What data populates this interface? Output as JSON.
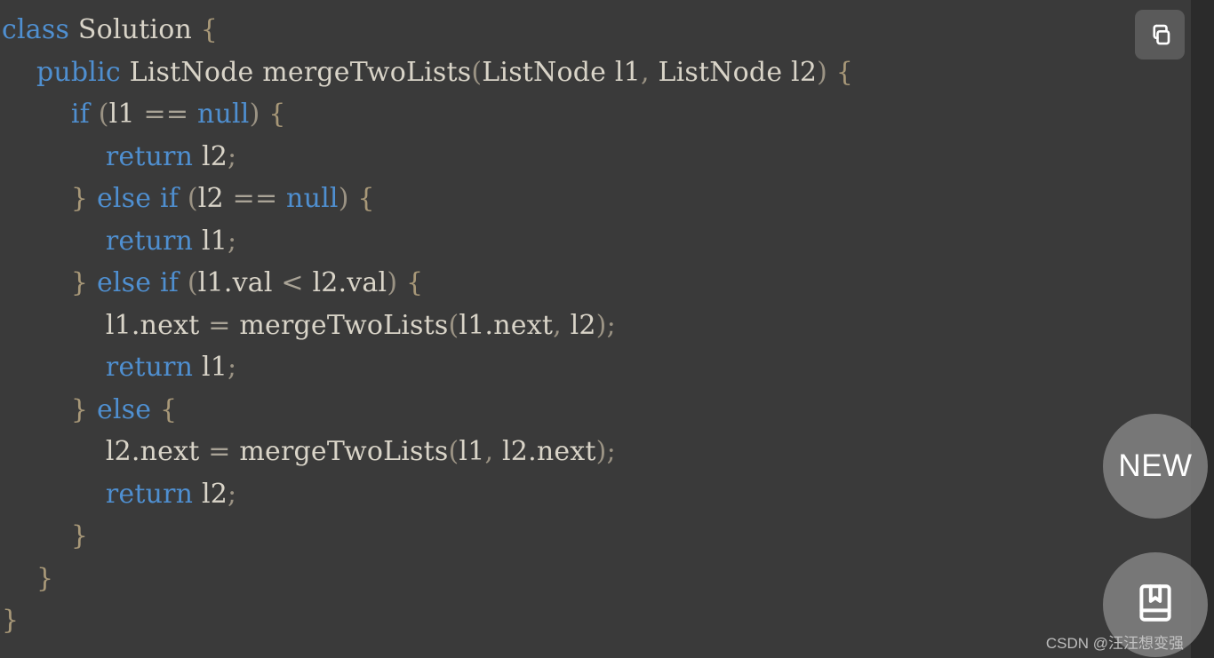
{
  "editor": {
    "language": "java",
    "background_color": "#3a3a3a",
    "rail_color": "#2b2b2b",
    "keyword_color": "#4f8fd0",
    "identifier_color": "#d9d4c8",
    "brace_color": "#a89878",
    "operator_color": "#a9a396",
    "code_lines": [
      [
        {
          "t": "class",
          "c": "kw"
        },
        {
          "t": " ",
          "c": "id"
        },
        {
          "t": "Solution",
          "c": "id"
        },
        {
          "t": " ",
          "c": "id"
        },
        {
          "t": "{",
          "c": "brace"
        }
      ],
      [
        {
          "t": "    ",
          "c": "id"
        },
        {
          "t": "public",
          "c": "kw"
        },
        {
          "t": " ",
          "c": "id"
        },
        {
          "t": "ListNode",
          "c": "id"
        },
        {
          "t": " ",
          "c": "id"
        },
        {
          "t": "mergeTwoLists",
          "c": "id"
        },
        {
          "t": "(",
          "c": "punc"
        },
        {
          "t": "ListNode",
          "c": "id"
        },
        {
          "t": " ",
          "c": "id"
        },
        {
          "t": "l1",
          "c": "id"
        },
        {
          "t": ", ",
          "c": "punc"
        },
        {
          "t": "ListNode",
          "c": "id"
        },
        {
          "t": " ",
          "c": "id"
        },
        {
          "t": "l2",
          "c": "id"
        },
        {
          "t": ")",
          "c": "punc"
        },
        {
          "t": " ",
          "c": "id"
        },
        {
          "t": "{",
          "c": "brace"
        }
      ],
      [
        {
          "t": "        ",
          "c": "id"
        },
        {
          "t": "if",
          "c": "kw"
        },
        {
          "t": " ",
          "c": "id"
        },
        {
          "t": "(",
          "c": "punc"
        },
        {
          "t": "l1",
          "c": "id"
        },
        {
          "t": " ",
          "c": "id"
        },
        {
          "t": "==",
          "c": "op"
        },
        {
          "t": " ",
          "c": "id"
        },
        {
          "t": "null",
          "c": "kw"
        },
        {
          "t": ")",
          "c": "punc"
        },
        {
          "t": " ",
          "c": "id"
        },
        {
          "t": "{",
          "c": "brace"
        }
      ],
      [
        {
          "t": "            ",
          "c": "id"
        },
        {
          "t": "return",
          "c": "kw"
        },
        {
          "t": " ",
          "c": "id"
        },
        {
          "t": "l2",
          "c": "id"
        },
        {
          "t": ";",
          "c": "punc"
        }
      ],
      [
        {
          "t": "        ",
          "c": "id"
        },
        {
          "t": "}",
          "c": "brace"
        },
        {
          "t": " ",
          "c": "id"
        },
        {
          "t": "else",
          "c": "kw"
        },
        {
          "t": " ",
          "c": "id"
        },
        {
          "t": "if",
          "c": "kw"
        },
        {
          "t": " ",
          "c": "id"
        },
        {
          "t": "(",
          "c": "punc"
        },
        {
          "t": "l2",
          "c": "id"
        },
        {
          "t": " ",
          "c": "id"
        },
        {
          "t": "==",
          "c": "op"
        },
        {
          "t": " ",
          "c": "id"
        },
        {
          "t": "null",
          "c": "kw"
        },
        {
          "t": ")",
          "c": "punc"
        },
        {
          "t": " ",
          "c": "id"
        },
        {
          "t": "{",
          "c": "brace"
        }
      ],
      [
        {
          "t": "            ",
          "c": "id"
        },
        {
          "t": "return",
          "c": "kw"
        },
        {
          "t": " ",
          "c": "id"
        },
        {
          "t": "l1",
          "c": "id"
        },
        {
          "t": ";",
          "c": "punc"
        }
      ],
      [
        {
          "t": "        ",
          "c": "id"
        },
        {
          "t": "}",
          "c": "brace"
        },
        {
          "t": " ",
          "c": "id"
        },
        {
          "t": "else",
          "c": "kw"
        },
        {
          "t": " ",
          "c": "id"
        },
        {
          "t": "if",
          "c": "kw"
        },
        {
          "t": " ",
          "c": "id"
        },
        {
          "t": "(",
          "c": "punc"
        },
        {
          "t": "l1.val",
          "c": "id"
        },
        {
          "t": " ",
          "c": "id"
        },
        {
          "t": "<",
          "c": "op"
        },
        {
          "t": " ",
          "c": "id"
        },
        {
          "t": "l2.val",
          "c": "id"
        },
        {
          "t": ")",
          "c": "punc"
        },
        {
          "t": " ",
          "c": "id"
        },
        {
          "t": "{",
          "c": "brace"
        }
      ],
      [
        {
          "t": "            ",
          "c": "id"
        },
        {
          "t": "l1.next",
          "c": "id"
        },
        {
          "t": " ",
          "c": "id"
        },
        {
          "t": "=",
          "c": "op"
        },
        {
          "t": " ",
          "c": "id"
        },
        {
          "t": "mergeTwoLists",
          "c": "id"
        },
        {
          "t": "(",
          "c": "punc"
        },
        {
          "t": "l1.next",
          "c": "id"
        },
        {
          "t": ", ",
          "c": "punc"
        },
        {
          "t": "l2",
          "c": "id"
        },
        {
          "t": ")",
          "c": "punc"
        },
        {
          "t": ";",
          "c": "punc"
        }
      ],
      [
        {
          "t": "            ",
          "c": "id"
        },
        {
          "t": "return",
          "c": "kw"
        },
        {
          "t": " ",
          "c": "id"
        },
        {
          "t": "l1",
          "c": "id"
        },
        {
          "t": ";",
          "c": "punc"
        }
      ],
      [
        {
          "t": "        ",
          "c": "id"
        },
        {
          "t": "}",
          "c": "brace"
        },
        {
          "t": " ",
          "c": "id"
        },
        {
          "t": "else",
          "c": "kw"
        },
        {
          "t": " ",
          "c": "id"
        },
        {
          "t": "{",
          "c": "brace"
        }
      ],
      [
        {
          "t": "            ",
          "c": "id"
        },
        {
          "t": "l2.next",
          "c": "id"
        },
        {
          "t": " ",
          "c": "id"
        },
        {
          "t": "=",
          "c": "op"
        },
        {
          "t": " ",
          "c": "id"
        },
        {
          "t": "mergeTwoLists",
          "c": "id"
        },
        {
          "t": "(",
          "c": "punc"
        },
        {
          "t": "l1",
          "c": "id"
        },
        {
          "t": ", ",
          "c": "punc"
        },
        {
          "t": "l2.next",
          "c": "id"
        },
        {
          "t": ")",
          "c": "punc"
        },
        {
          "t": ";",
          "c": "punc"
        }
      ],
      [
        {
          "t": "            ",
          "c": "id"
        },
        {
          "t": "return",
          "c": "kw"
        },
        {
          "t": " ",
          "c": "id"
        },
        {
          "t": "l2",
          "c": "id"
        },
        {
          "t": ";",
          "c": "punc"
        }
      ],
      [
        {
          "t": "        ",
          "c": "id"
        },
        {
          "t": "}",
          "c": "brace"
        }
      ],
      [
        {
          "t": "    ",
          "c": "id"
        },
        {
          "t": "}",
          "c": "brace"
        }
      ],
      [
        {
          "t": "}",
          "c": "brace"
        }
      ]
    ]
  },
  "controls": {
    "copy_button": {
      "icon": "copy-icon",
      "tooltip": "Copy"
    },
    "fab_new": {
      "label": "NEW",
      "icon": "new-badge"
    },
    "fab_book": {
      "icon": "book-icon"
    }
  },
  "watermark": {
    "text": "CSDN @汪汪想变强"
  }
}
